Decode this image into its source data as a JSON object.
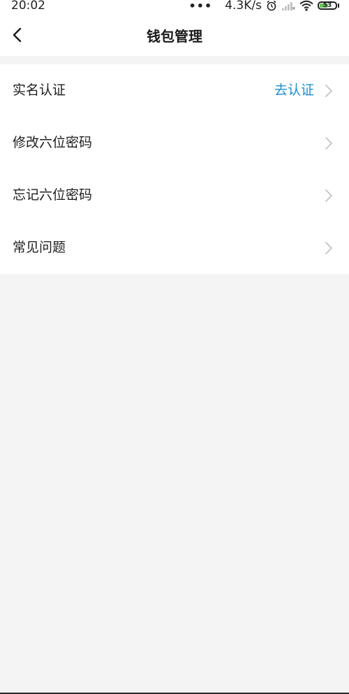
{
  "status_bar": {
    "time": "20:02",
    "dots": "•••",
    "speed": "4.3K/s",
    "battery": "53",
    "icons": [
      "alarm-icon",
      "signal-icon",
      "wifi-icon",
      "battery-icon"
    ]
  },
  "header": {
    "title": "钱包管理",
    "back_icon": "chevron-left-icon"
  },
  "menu": {
    "items": [
      {
        "label": "实名认证",
        "value": "去认证"
      },
      {
        "label": "修改六位密码",
        "value": ""
      },
      {
        "label": "忘记六位密码",
        "value": ""
      },
      {
        "label": "常见问题",
        "value": ""
      }
    ]
  },
  "colors": {
    "accent": "#1a8fd0",
    "background": "#f4f4f4",
    "card": "#ffffff",
    "chevron": "#c4c4c4",
    "battery": "#6ac259"
  }
}
